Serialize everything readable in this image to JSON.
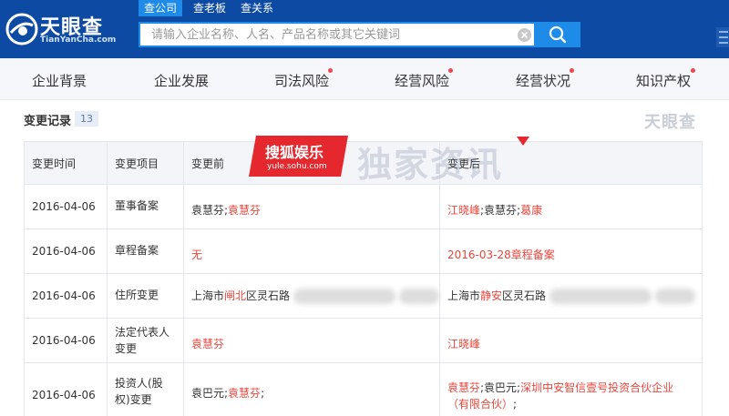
{
  "header": {
    "logo_text": "天眼查",
    "logo_sub": "TianYanCha.com",
    "search_tabs": [
      "查公司",
      "查老板",
      "查关系"
    ],
    "search_placeholder": "请输入企业名称、人名、产品名称或其它关键词"
  },
  "nav": {
    "items": [
      {
        "label": "企业背景",
        "dot": false
      },
      {
        "label": "企业发展",
        "dot": false
      },
      {
        "label": "司法风险",
        "dot": true
      },
      {
        "label": "经营风险",
        "dot": true
      },
      {
        "label": "经营状况",
        "dot": true
      },
      {
        "label": "知识产权",
        "dot": true
      }
    ]
  },
  "section": {
    "title": "变更记录",
    "count": "13",
    "watermark": "天眼查"
  },
  "overlay": {
    "sohu_name": "搜狐娱乐",
    "sohu_url": "yule.sohu.com",
    "faint_text": "独家资讯"
  },
  "table": {
    "headers": [
      "变更时间",
      "变更项目",
      "变更前",
      "变更后"
    ],
    "rows": [
      {
        "date": "2016-04-06",
        "item": [
          "董事备案"
        ],
        "before": [
          {
            "t": "袁慧芬;",
            "red": false
          },
          {
            "t": "袁慧芬",
            "red": true
          }
        ],
        "after": [
          {
            "t": "江晓峰",
            "red": true
          },
          {
            "t": ";袁慧芬;",
            "red": false
          },
          {
            "t": "葛康",
            "red": true
          }
        ]
      },
      {
        "date": "2016-04-06",
        "item": [
          "章程备案"
        ],
        "before": [
          {
            "t": "无",
            "red": true
          }
        ],
        "after": [
          {
            "t": "2016-03-28章程备案",
            "red": true
          }
        ]
      },
      {
        "date": "2016-04-06",
        "item": [
          "住所变更"
        ],
        "before": [
          {
            "t": "上海市",
            "red": false
          },
          {
            "t": "闸北",
            "red": true
          },
          {
            "t": "区灵石路",
            "red": false
          }
        ],
        "after": [
          {
            "t": "上海市",
            "red": false
          },
          {
            "t": "静安",
            "red": true
          },
          {
            "t": "区灵石路",
            "red": false
          }
        ]
      },
      {
        "date": "2016-04-06",
        "item": [
          "法定代表人",
          "变更"
        ],
        "before": [
          {
            "t": "袁慧芬",
            "red": true
          }
        ],
        "after": [
          {
            "t": "江晓峰",
            "red": true
          }
        ]
      },
      {
        "date": "2016-04-06",
        "item": [
          "投资人(股",
          "权)变更"
        ],
        "before": [
          {
            "t": "袁巴元;",
            "red": false
          },
          {
            "t": "袁慧芬",
            "red": true
          },
          {
            "t": ";",
            "red": false
          }
        ],
        "after": [
          {
            "t": "袁慧芬",
            "red": true
          },
          {
            "t": ";袁巴元;",
            "red": false
          },
          {
            "t": "深圳中安智信壹号投资合伙企业（有限合伙）",
            "red": true
          },
          {
            "t": ";",
            "red": false
          }
        ]
      }
    ]
  },
  "colors": {
    "header_bg": "#0c4aa3",
    "accent": "#1f8be8",
    "highlight_red": "#e8463c",
    "sohu_red": "#e5282e"
  }
}
